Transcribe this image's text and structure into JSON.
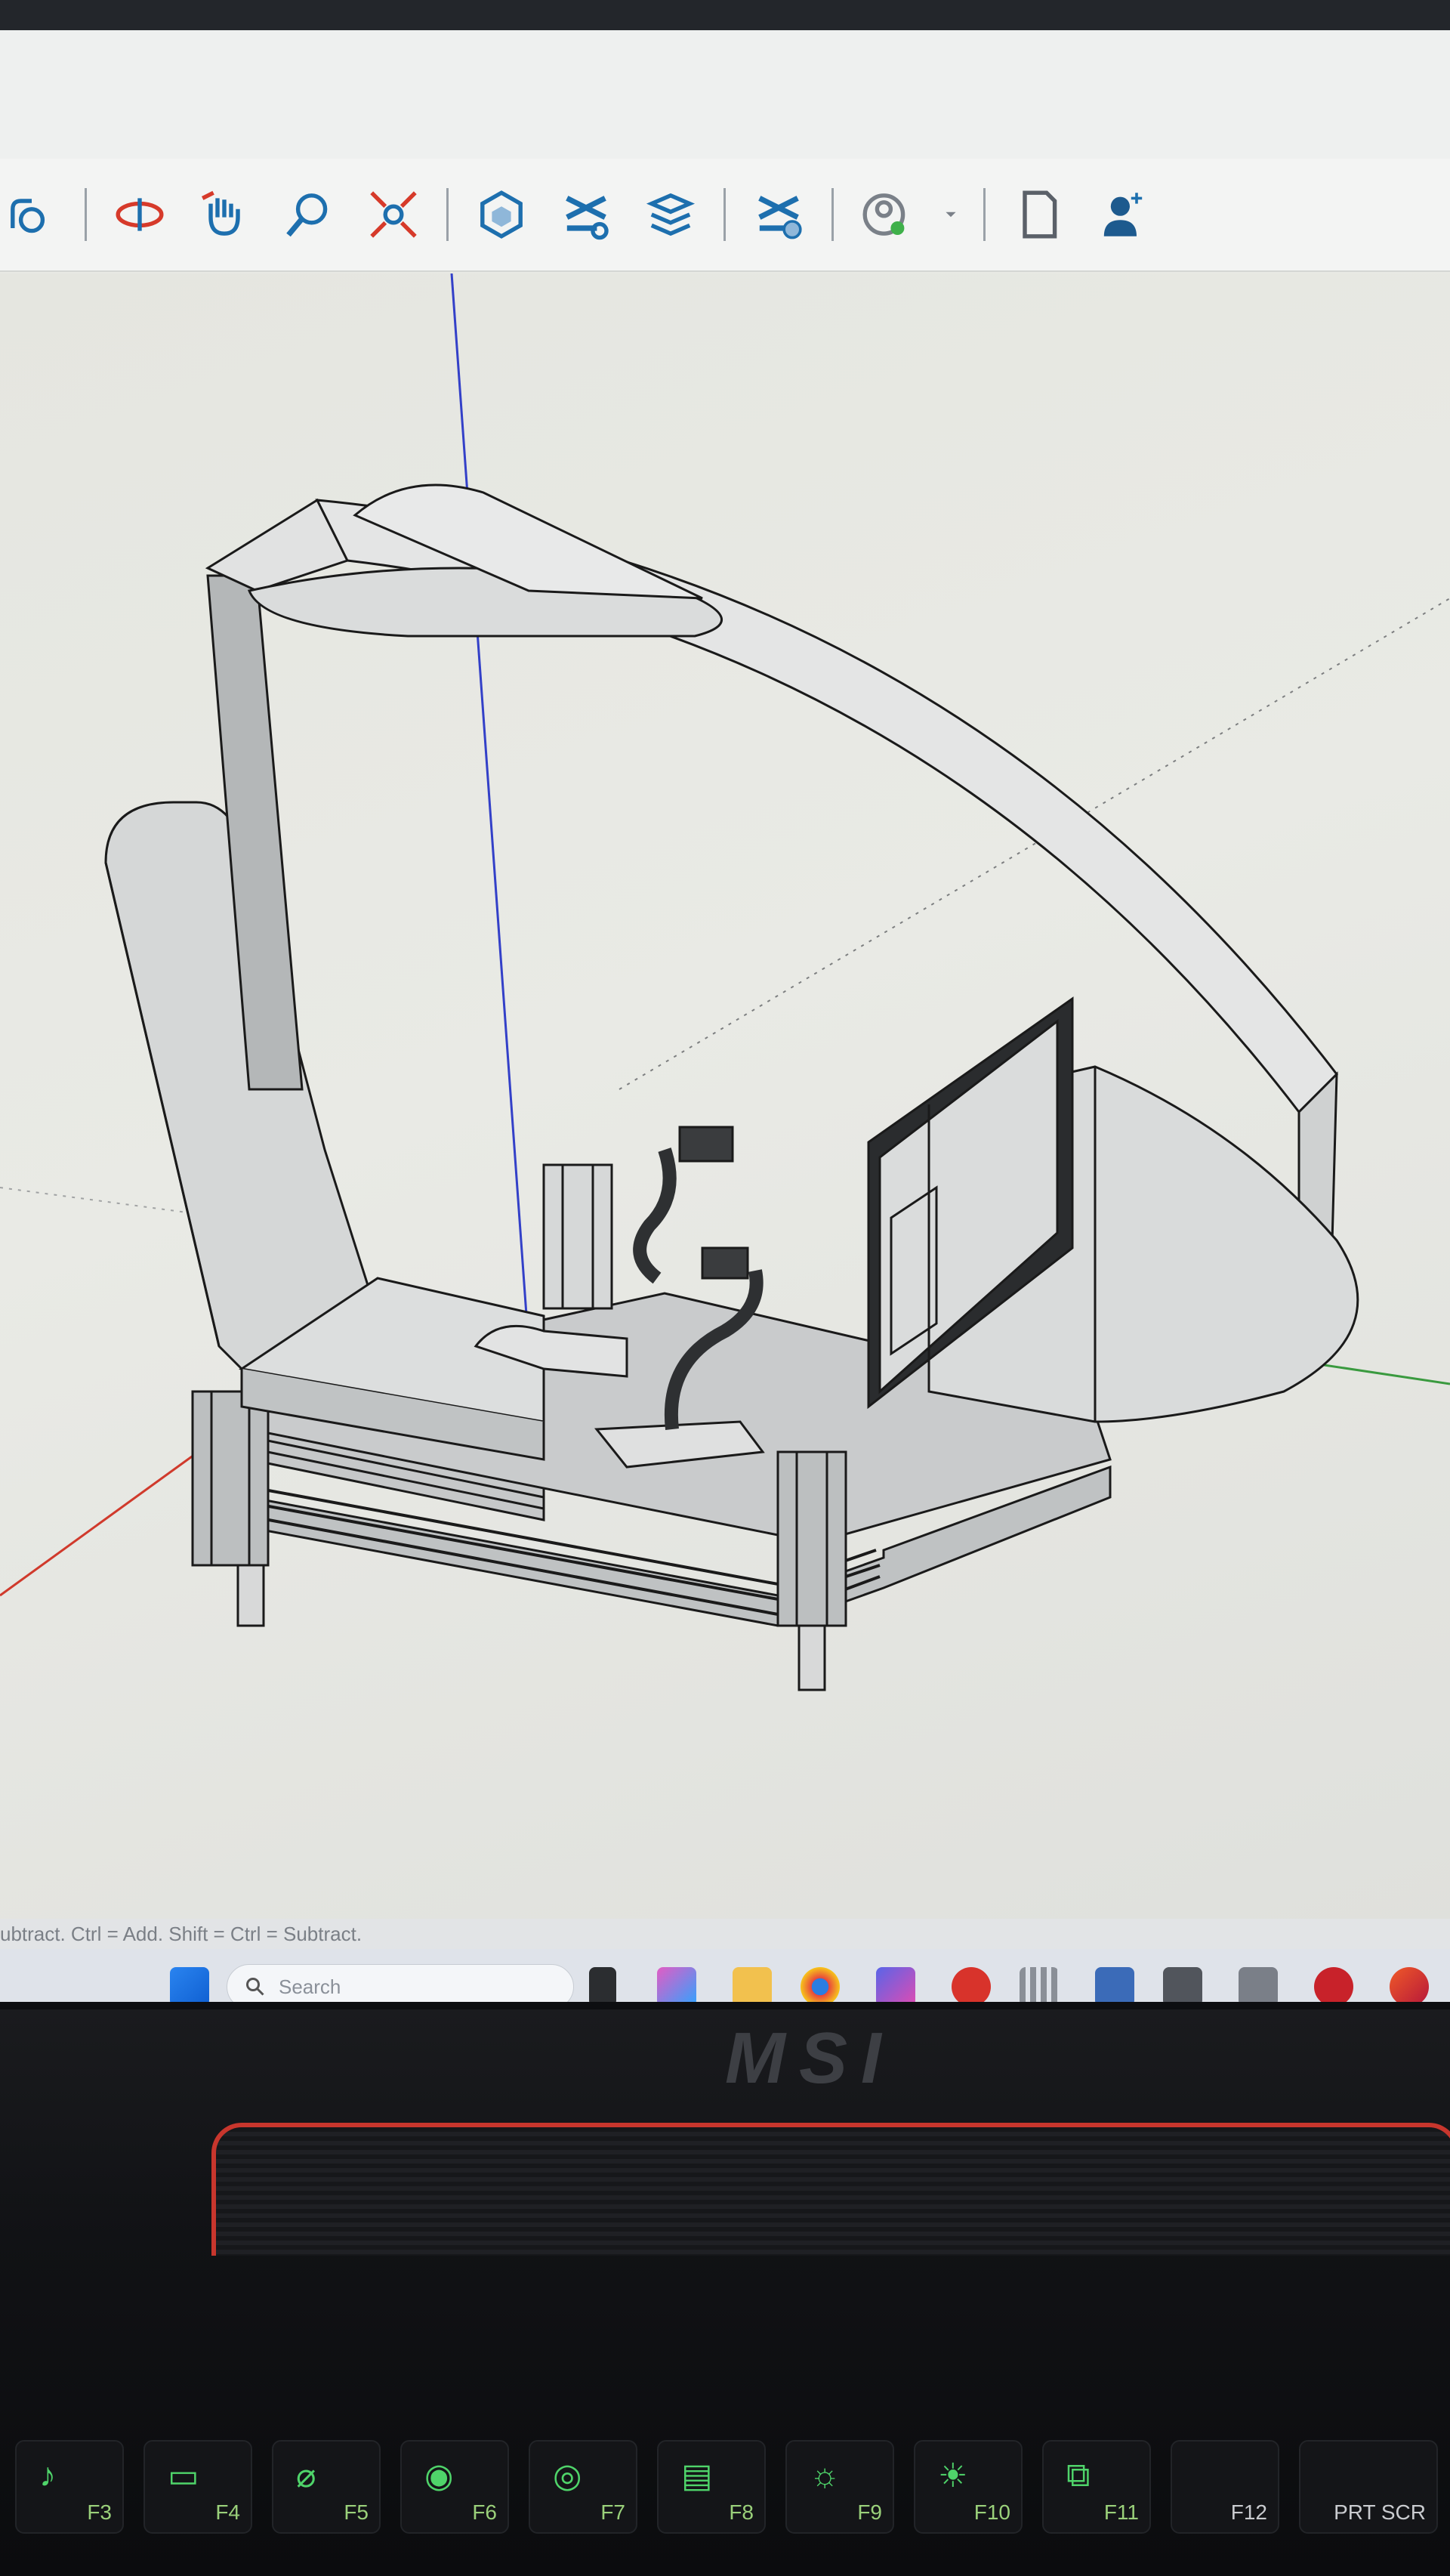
{
  "toolbar": {
    "tools": [
      {
        "name": "pan-icon"
      },
      {
        "name": "orbit-icon"
      },
      {
        "name": "pan-hand-icon"
      },
      {
        "name": "zoom-icon"
      },
      {
        "name": "zoom-extents-icon"
      },
      {
        "name": "component-icon"
      },
      {
        "name": "intersect-icon"
      },
      {
        "name": "layers-icon"
      },
      {
        "name": "solid-tools-icon"
      },
      {
        "name": "account-icon"
      },
      {
        "name": "new-file-icon"
      },
      {
        "name": "add-user-icon"
      }
    ]
  },
  "status_bar": {
    "text": "ubtract. Ctrl = Add. Shift = Ctrl = Subtract."
  },
  "taskbar": {
    "search_placeholder": "Search"
  },
  "laptop": {
    "brand": "MSI",
    "keys": [
      "F3",
      "F4",
      "F5",
      "F6",
      "F7",
      "F8",
      "F9",
      "F10",
      "F11",
      "F12",
      "PRT SCR"
    ]
  },
  "colors": {
    "axis_blue": "#3340c8",
    "axis_red": "#d03a2c",
    "axis_green": "#3a9a3f",
    "accent": "#1d6fae"
  }
}
